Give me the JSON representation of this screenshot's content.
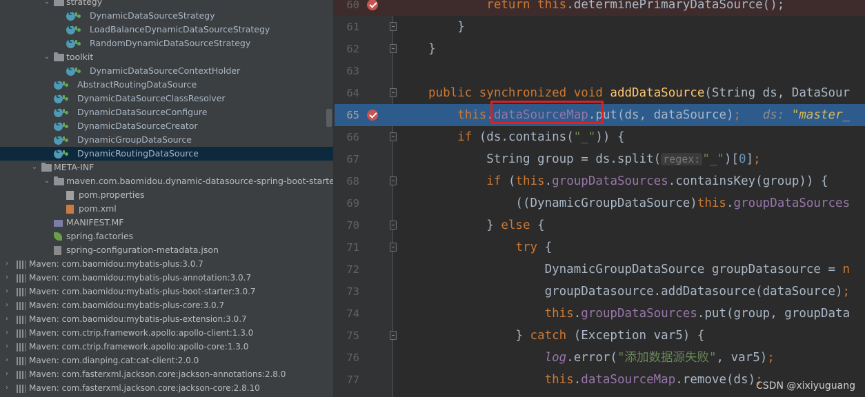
{
  "project_tree": {
    "items": [
      {
        "label": "strategy",
        "kind": "folder",
        "expanded": true
      },
      {
        "label": "DynamicDataSourceStrategy",
        "kind": "class"
      },
      {
        "label": "LoadBalanceDynamicDataSourceStrategy",
        "kind": "class"
      },
      {
        "label": "RandomDynamicDataSourceStrategy",
        "kind": "class"
      },
      {
        "label": "toolkit",
        "kind": "folder",
        "expanded": true
      },
      {
        "label": "DynamicDataSourceContextHolder",
        "kind": "class"
      },
      {
        "label": "AbstractRoutingDataSource",
        "kind": "class"
      },
      {
        "label": "DynamicDataSourceClassResolver",
        "kind": "class"
      },
      {
        "label": "DynamicDataSourceConfigure",
        "kind": "class"
      },
      {
        "label": "DynamicDataSourceCreator",
        "kind": "class"
      },
      {
        "label": "DynamicGroupDataSource",
        "kind": "class"
      },
      {
        "label": "DynamicRoutingDataSource",
        "kind": "class",
        "selected": true
      },
      {
        "label": "META-INF",
        "kind": "folder",
        "expanded": true
      },
      {
        "label": "maven.com.baomidou.dynamic-datasource-spring-boot-starter",
        "kind": "folder",
        "expanded": true
      },
      {
        "label": "pom.properties",
        "kind": "properties-file"
      },
      {
        "label": "pom.xml",
        "kind": "xml-file"
      },
      {
        "label": "MANIFEST.MF",
        "kind": "manifest-file"
      },
      {
        "label": "spring.factories",
        "kind": "spring-file"
      },
      {
        "label": "spring-configuration-metadata.json",
        "kind": "json-file"
      }
    ],
    "libraries": [
      "Maven: com.baomidou:mybatis-plus:3.0.7",
      "Maven: com.baomidou:mybatis-plus-annotation:3.0.7",
      "Maven: com.baomidou:mybatis-plus-boot-starter:3.0.7",
      "Maven: com.baomidou:mybatis-plus-core:3.0.7",
      "Maven: com.baomidou:mybatis-plus-extension:3.0.7",
      "Maven: com.ctrip.framework.apollo:apollo-client:1.3.0",
      "Maven: com.ctrip.framework.apollo:apollo-core:1.3.0",
      "Maven: com.dianping.cat:cat-client:2.0.0",
      "Maven: com.fasterxml.jackson.core:jackson-annotations:2.8.0",
      "Maven: com.fasterxml.jackson.core:jackson-core:2.8.10"
    ]
  },
  "editor": {
    "line_numbers": [
      "60",
      "61",
      "62",
      "63",
      "64",
      "65",
      "66",
      "67",
      "68",
      "69",
      "70",
      "71",
      "72",
      "73",
      "74",
      "75",
      "76",
      "77"
    ],
    "debug_value_label": "ds:",
    "debug_value": "\"master_",
    "param_hint": "regex:",
    "chinese_string": "\"添加数据源失败\""
  },
  "colors": {
    "keyword": "#cc7832",
    "method_decl": "#ffc66d",
    "field": "#9876aa",
    "string": "#6a8759",
    "number": "#6897bb",
    "execution_line": "#2d5b8c",
    "breakpoint": "#c75450",
    "highlight_box": "#e02020"
  },
  "watermark": "CSDN @xixiyuguang"
}
